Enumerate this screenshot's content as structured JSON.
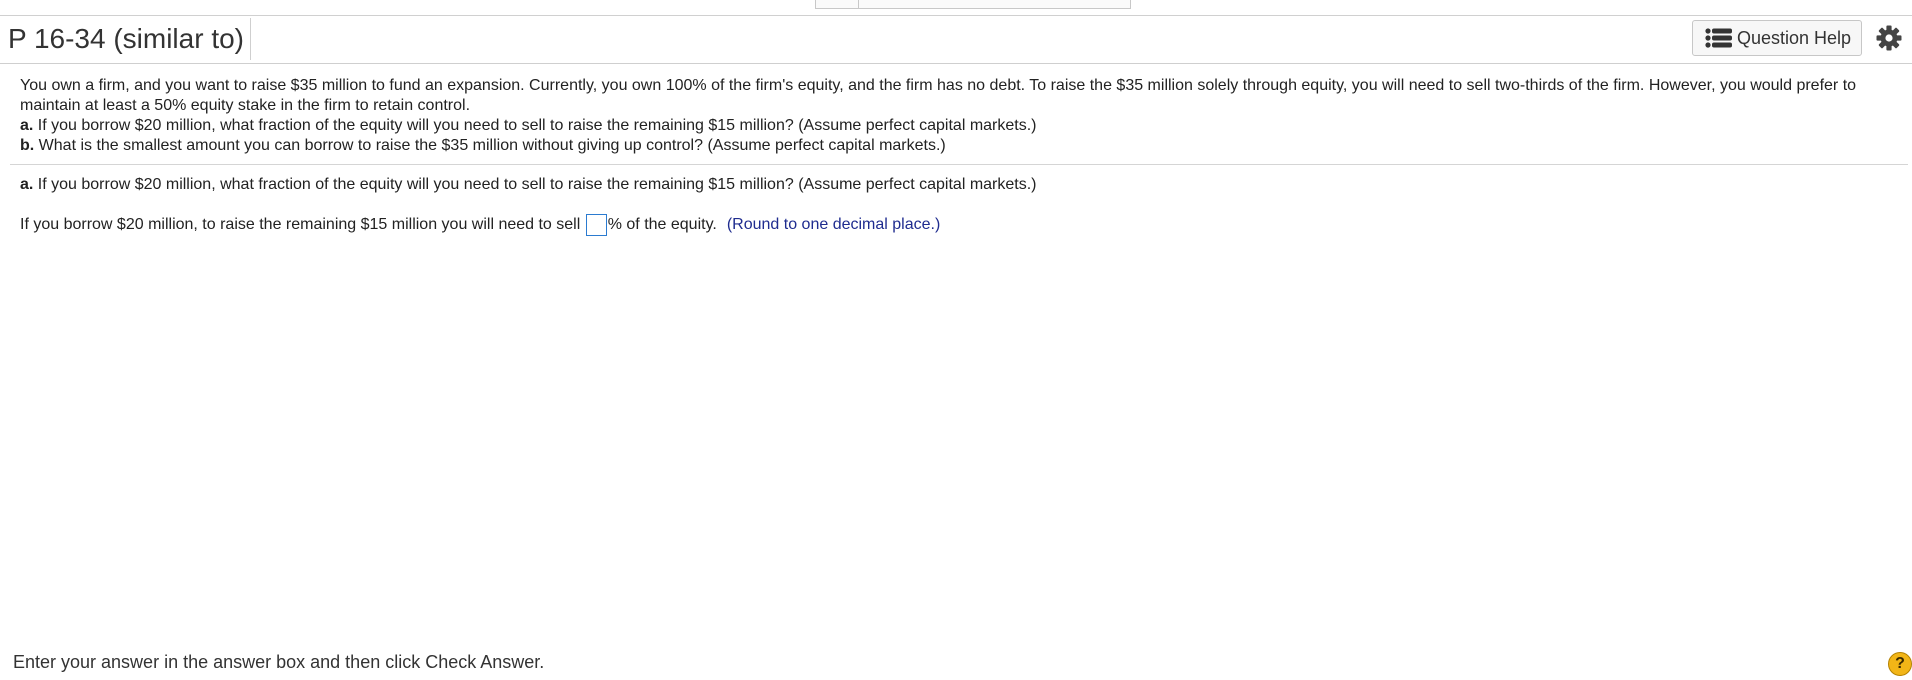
{
  "header": {
    "title": "P 16-34 (similar to)",
    "question_help_label": "Question Help",
    "question_help_icon": "list-icon",
    "settings_icon": "gear-icon"
  },
  "problem": {
    "intro": "You own a firm, and you want to raise $35 million to fund an expansion. Currently, you own 100% of the firm's equity, and the firm has no debt. To raise the $35 million solely through equity, you will need to sell two-thirds of the firm.  However, you would prefer to maintain at least a 50% equity stake in the firm to retain control.",
    "a_prefix": "a.",
    "a_text": " If you borrow $20 million, what fraction of the equity will you need to sell to raise the remaining $15 million? (Assume perfect capital markets.)",
    "b_prefix": "b.",
    "b_text": " What is the smallest amount you can borrow to raise the $35 million without giving up control? (Assume perfect capital markets.)"
  },
  "current_part": {
    "prefix": "a.",
    "text": " If you borrow $20 million, what fraction of the equity will you need to sell to raise the remaining $15 million? (Assume perfect capital markets.)",
    "answer_before": "If you borrow $20 million, to raise the remaining $15 million you will need to sell ",
    "answer_value": "",
    "answer_after": "% of the equity.",
    "hint": "(Round to one decimal place.)"
  },
  "footer": {
    "instruction": "Enter your answer in the answer box and then click Check Answer.",
    "help_symbol": "?"
  },
  "colors": {
    "hint": "#1f2c8f",
    "answer_box_border": "#2b7bd0",
    "help_circle": "#f2b517"
  }
}
